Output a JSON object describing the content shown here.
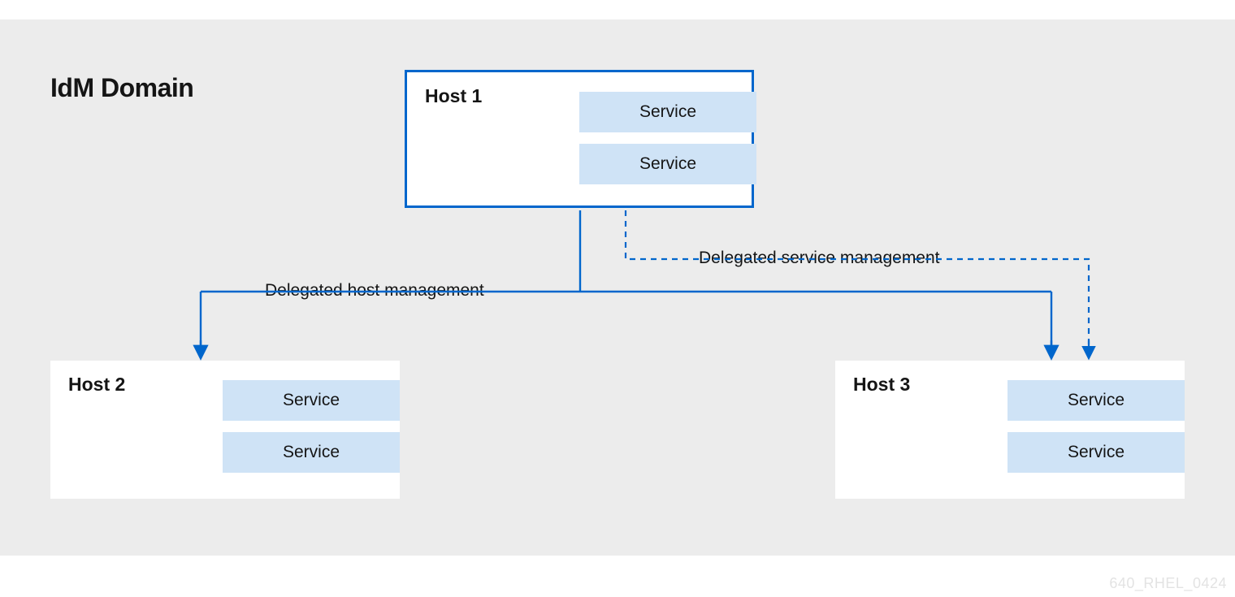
{
  "diagram": {
    "title": "IdM Domain",
    "host1": {
      "name": "Host 1",
      "svc1": "Service",
      "svc2": "Service"
    },
    "host2": {
      "name": "Host 2",
      "svc1": "Service",
      "svc2": "Service"
    },
    "host3": {
      "name": "Host 3",
      "svc1": "Service",
      "svc2": "Service"
    },
    "connectors": {
      "host_mgmt": "Delegated host management",
      "svc_mgmt": "Delegated service management"
    },
    "watermark": "640_RHEL_0424",
    "colors": {
      "blue": "#06c",
      "svc_bg": "#cfe3f6",
      "canvas": "#ececec"
    }
  }
}
